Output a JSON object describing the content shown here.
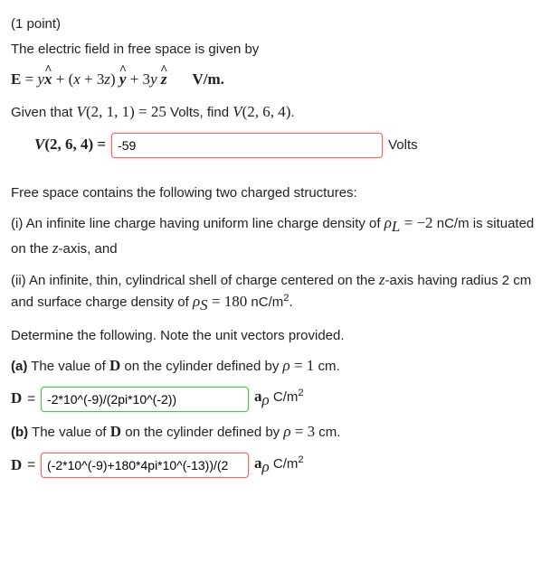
{
  "header": {
    "points": "(1 point)",
    "intro": "The electric field in free space is given by"
  },
  "eq_field": {
    "E": "E",
    "eq": " = ",
    "t1": "y",
    "xhat": "x",
    "plus1": " + (",
    "t2": "x",
    "plus2": " + 3",
    "t3": "z",
    "close": ") ",
    "yhat": "y",
    "plus3": " + 3",
    "t4": "y ",
    "zhat": "z",
    "units": "V/m."
  },
  "given": {
    "pre": "Given that ",
    "V": "V",
    "p1": "(2, 1, 1) = 25",
    "volts": " Volts, find ",
    "V2": "V",
    "p2": "(2, 6, 4)",
    "dot": "."
  },
  "ans1": {
    "lhs_V": "V",
    "lhs_args": "(2, 6, 4) = ",
    "value": "-59",
    "unit": "Volts"
  },
  "sec2_intro": "Free space contains the following two charged structures:",
  "part_i": {
    "pre": "(i) An infinite line charge having uniform line charge density of ",
    "rho": "ρ",
    "sub": "L",
    "eq": " = ",
    "val": "−2",
    "unit": " nC/m is situated on the ",
    "axis": "z",
    "post": "-axis, and"
  },
  "part_ii": {
    "pre": "(ii) An infinite, thin, cylindrical shell of charge centered on the ",
    "axis": "z",
    "post1": "-axis having radius 2 cm and surface charge density of ",
    "rho": "ρ",
    "sub": "S",
    "eq": " = 180",
    "unit": " nC/m",
    "sq": "2",
    "dot": "."
  },
  "determine": "Determine the following. Note the unit vectors provided.",
  "part_a": {
    "label": "(a)",
    "text": " The value of ",
    "D": "D",
    "text2": " on the cylinder defined by ",
    "rho": "ρ",
    "eq": " = 1",
    "unit": " cm."
  },
  "ans_a": {
    "D": "D",
    "eq": " = ",
    "value": "-2*10^(-9)/(2pi*10^(-2))",
    "a": "a",
    "sub": "ρ",
    "unit": " C/m",
    "sq": "2"
  },
  "part_b": {
    "label": "(b)",
    "text": " The value of ",
    "D": "D",
    "text2": " on the cylinder defined by ",
    "rho": "ρ",
    "eq": " = 3",
    "unit": " cm."
  },
  "ans_b": {
    "D": "D",
    "eq": " = ",
    "value": "(-2*10^(-9)+180*4pi*10^(-13))/(2",
    "a": "a",
    "sub": "ρ",
    "unit": " C/m",
    "sq": "2"
  }
}
